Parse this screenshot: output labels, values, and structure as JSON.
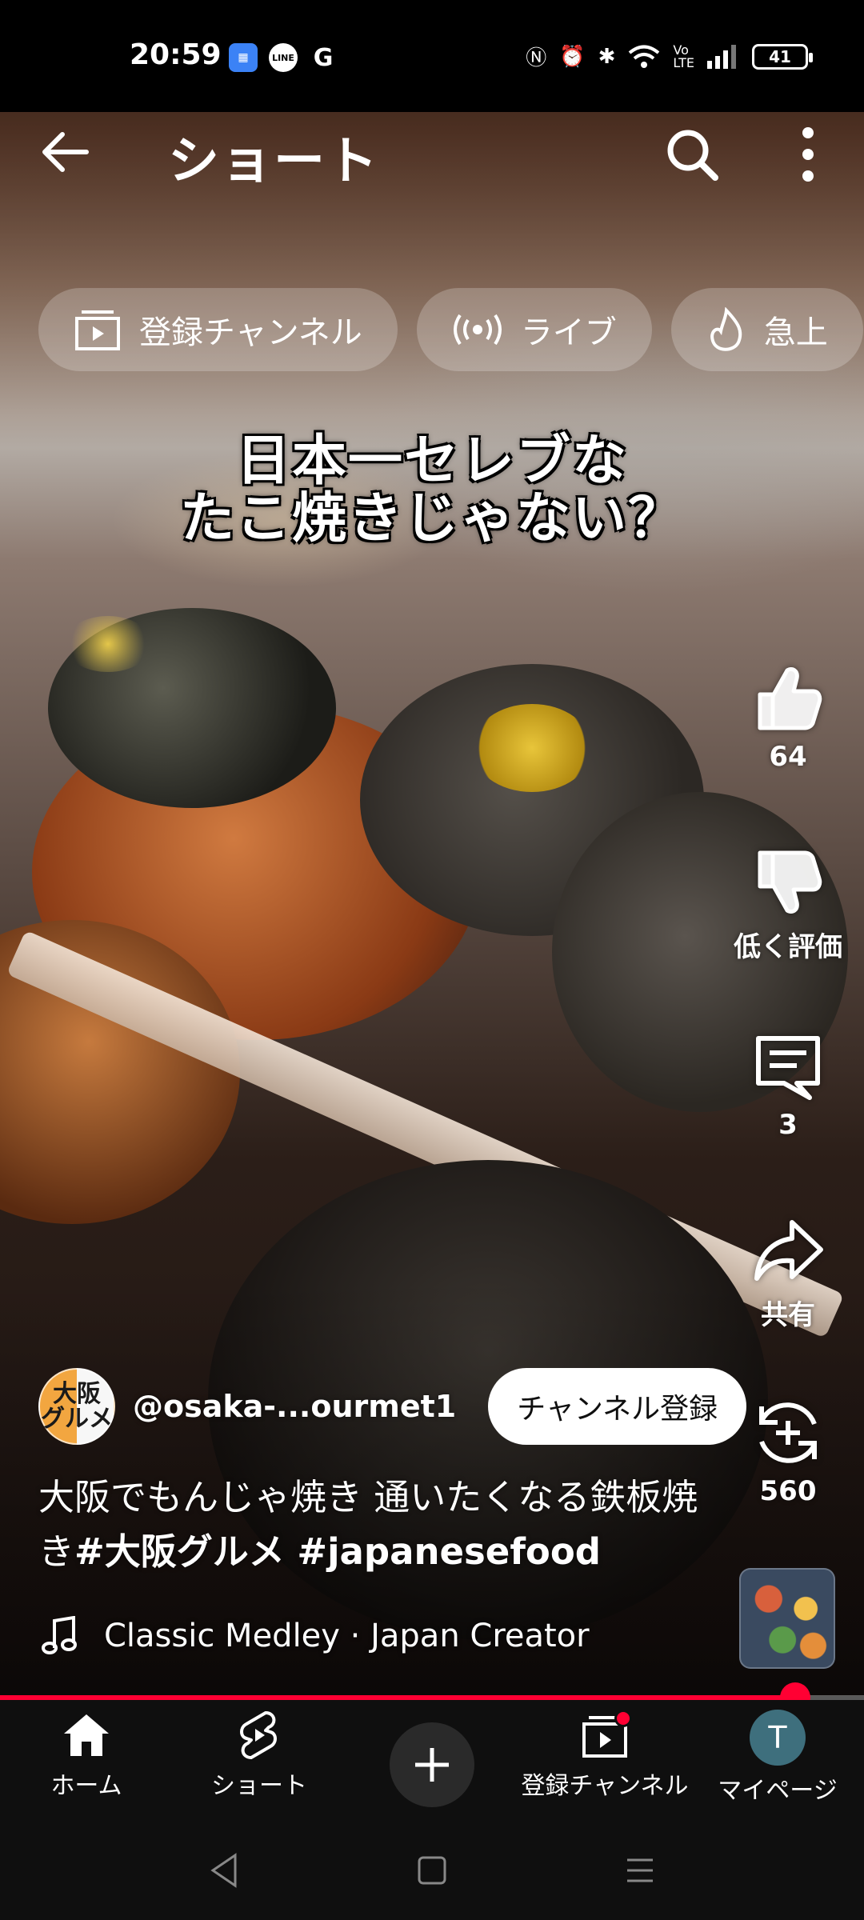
{
  "status_bar": {
    "time": "20:59",
    "apps": [
      "calendar-icon",
      "line-icon",
      "google-icon"
    ],
    "battery": "41"
  },
  "header": {
    "title": "ショート"
  },
  "chips": [
    {
      "label": "登録チャンネル",
      "icon": "subscriptions-icon"
    },
    {
      "label": "ライブ",
      "icon": "live-icon"
    },
    {
      "label": "急上",
      "icon": "trending-icon"
    }
  ],
  "video": {
    "caption_line1": "日本一セレブな",
    "caption_line2": "たこ焼きじゃない？"
  },
  "actions": {
    "like_count": "64",
    "dislike_label": "低く評価",
    "comment_count": "3",
    "share_label": "共有",
    "remix_count": "560"
  },
  "channel": {
    "avatar_text_line1": "大阪",
    "avatar_text_line2": "グルメ",
    "handle": "@osaka-...ourmet1",
    "subscribe_label": "チャンネル登録"
  },
  "title": {
    "text": "大阪でもんじゃ焼き 通いたくなる鉄板焼き",
    "hashtags": "#大阪グルメ #japanesefood"
  },
  "music": {
    "label": "Classic Medley · Japan Creator"
  },
  "progress": {
    "fraction": 0.92
  },
  "bottom_nav": {
    "home": "ホーム",
    "shorts": "ショート",
    "subscriptions": "登録チャンネル",
    "mypage": "マイページ",
    "user_initial": "T"
  },
  "colors": {
    "accent": "#ff0033",
    "nav_bg": "#0f0f0f"
  }
}
